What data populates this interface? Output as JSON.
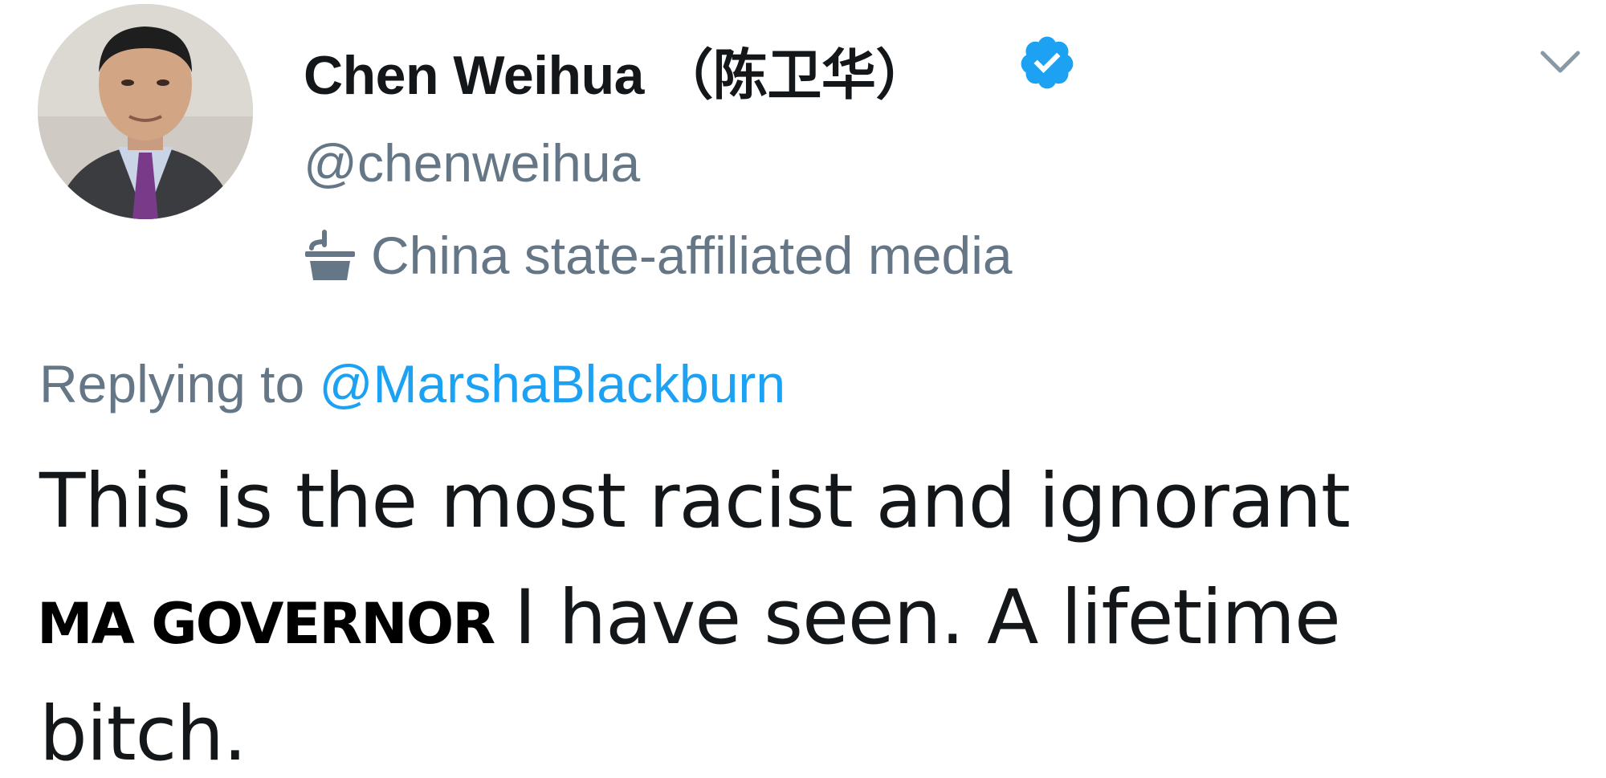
{
  "author": {
    "display_name": "Chen Weihua （陈卫华）",
    "handle": "@chenweihua",
    "verified": true,
    "label": "China state-affiliated media",
    "label_icon": "podium-icon",
    "avatar": "profile-photo"
  },
  "menu_icon": "chevron-down-icon",
  "reply": {
    "prefix": "Replying to",
    "mention": "@MarshaBlackburn"
  },
  "tweet": {
    "line1": "This is the most racist and ignorant",
    "line2": "I have seen.  A lifetime",
    "line3": "bitch."
  },
  "overlay_caption": "MA GOVERNOR",
  "colors": {
    "text": "#14171a",
    "muted": "#657786",
    "link": "#1da1f2",
    "verified": "#1da1f2"
  }
}
